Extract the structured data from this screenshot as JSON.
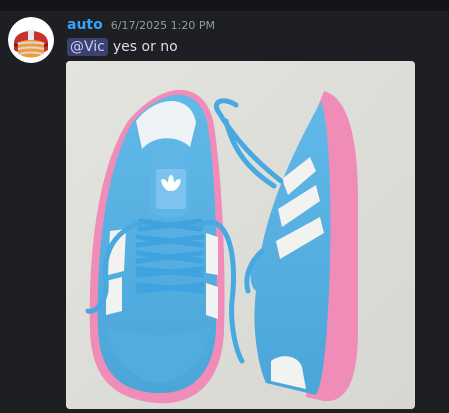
{
  "message": {
    "author": "auto",
    "timestamp": "6/17/2025 1:20 PM",
    "mention": "@Vic",
    "text": "yes or no"
  },
  "attachment": {
    "brand_text": "adidas",
    "tongue_text": "adidas",
    "product": "sneakers",
    "colors": {
      "suede": "#56b0e2",
      "sole": "#f08cb8",
      "stripes": "#f2f2f0",
      "background": "#e7e7e2"
    }
  },
  "colors": {
    "username": "#36a3ff",
    "timestamp": "#949ba4",
    "text": "#dbdee1",
    "mention_bg": "#3c4270",
    "mention_text": "#c9cdfb",
    "background": "#1e1f22"
  }
}
